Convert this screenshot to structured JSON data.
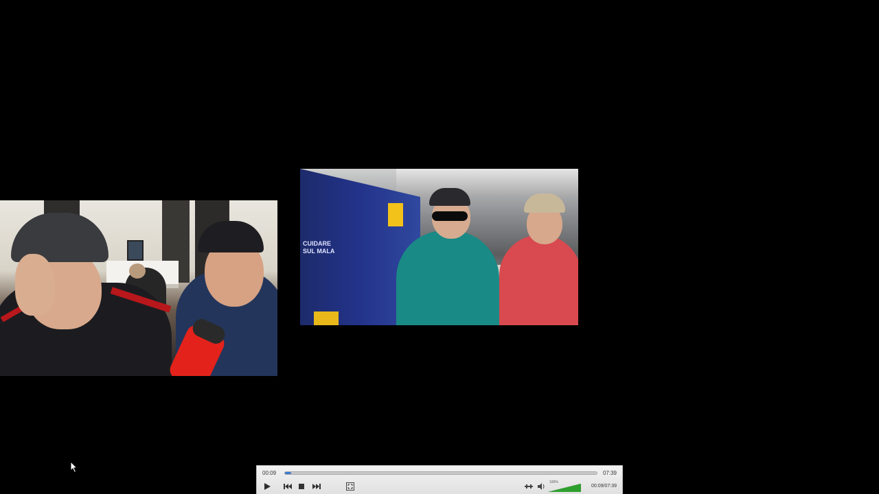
{
  "player": {
    "elapsed": "00:09",
    "total": "07:39",
    "readout": "00:09/07:39",
    "progress": 0.02,
    "volume": {
      "label": "100%",
      "level": 1.0
    },
    "colors": {
      "progress": "#3b7bd0",
      "volume_green": "#2ea02e"
    },
    "icons": [
      "play-icon",
      "previous-icon",
      "stop-icon",
      "next-icon",
      "fullscreen-icon",
      "extended-settings-icon",
      "speaker-icon"
    ]
  },
  "videos": {
    "right_frame": {
      "wall_text": [
        "CUIDARE",
        "SUL MALA"
      ]
    }
  }
}
